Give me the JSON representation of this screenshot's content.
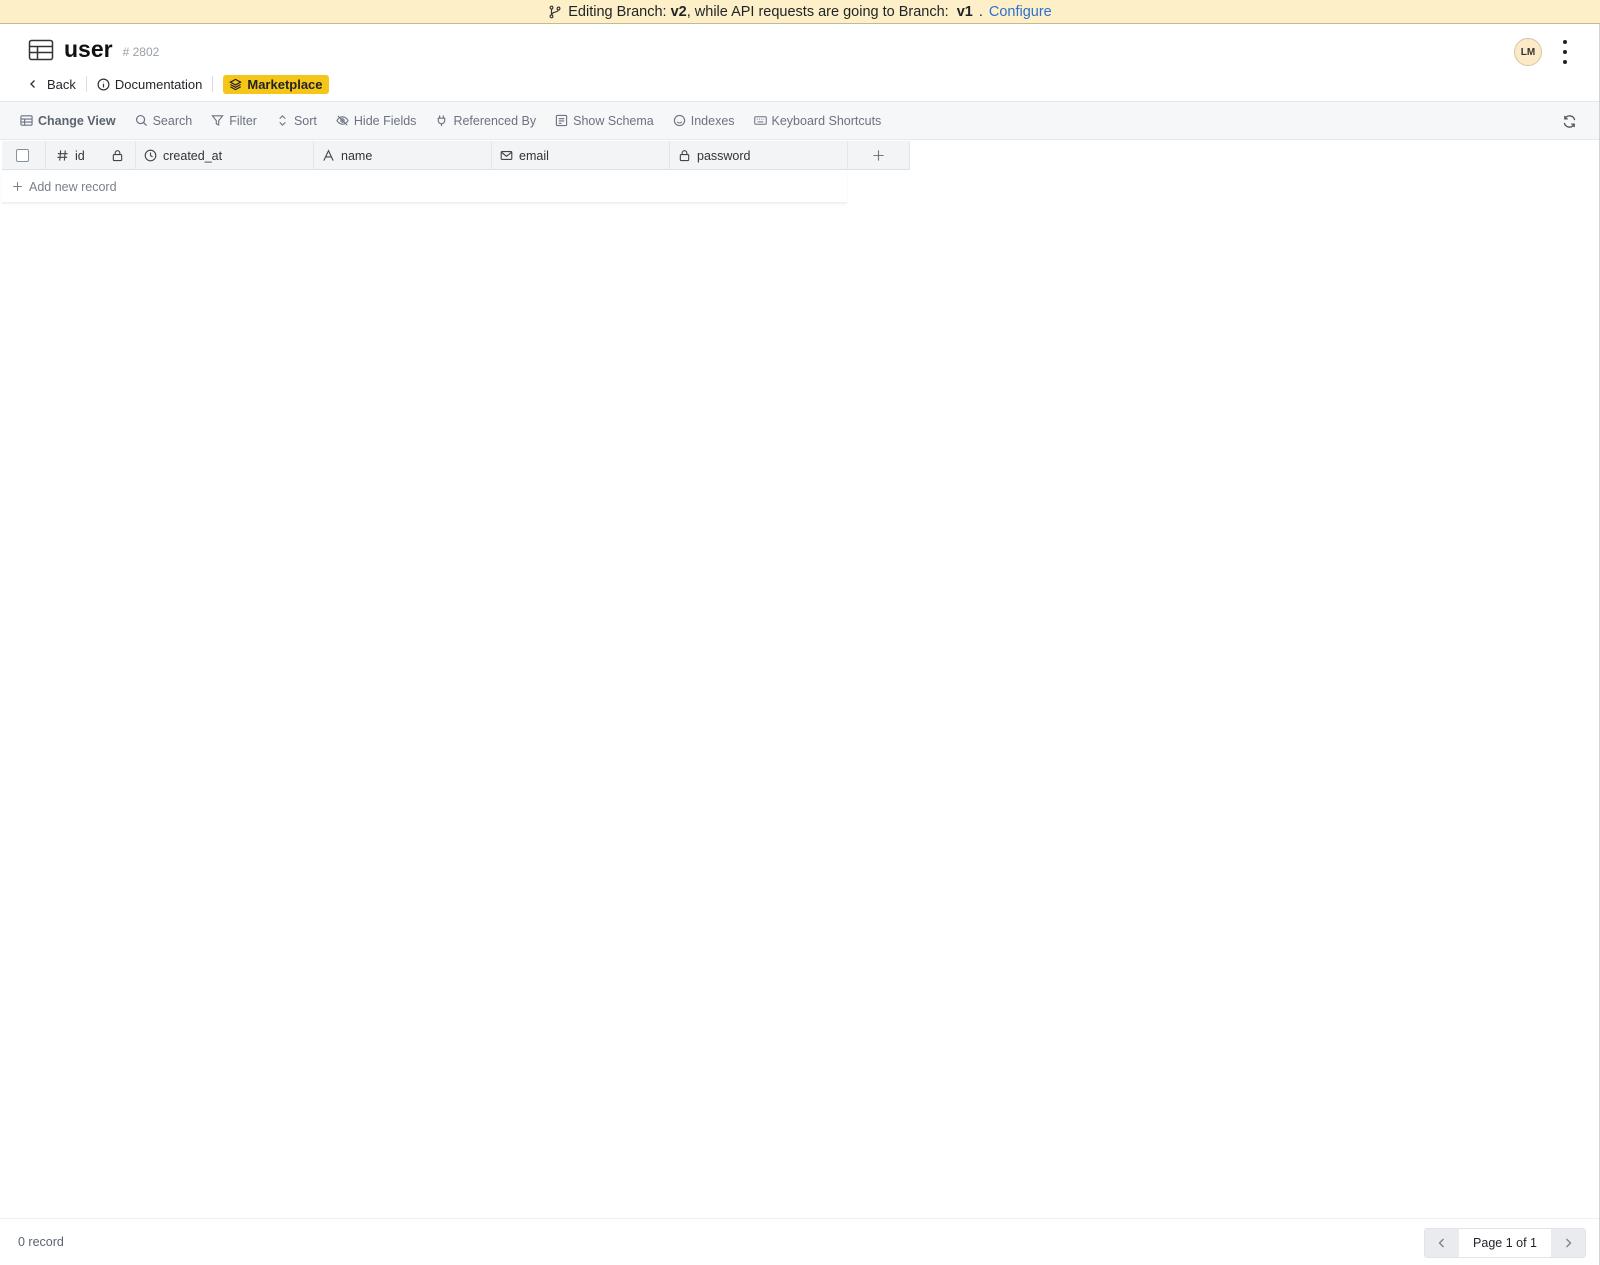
{
  "banner": {
    "prefix": "Editing Branch:",
    "editing_branch": "v2",
    "middle": ", while API requests are going to Branch:",
    "api_branch": "v1",
    "dot": ".",
    "configure": "Configure"
  },
  "header": {
    "title": "user",
    "table_id": "# 2802",
    "avatar_initials": "LM"
  },
  "nav": {
    "back": "Back",
    "documentation": "Documentation",
    "marketplace": "Marketplace"
  },
  "toolbar": {
    "change_view": "Change View",
    "search": "Search",
    "filter": "Filter",
    "sort": "Sort",
    "hide_fields": "Hide Fields",
    "referenced_by": "Referenced By",
    "show_schema": "Show Schema",
    "indexes": "Indexes",
    "keyboard_shortcuts": "Keyboard Shortcuts"
  },
  "grid": {
    "columns": [
      {
        "label": "id",
        "icon": "hash-icon"
      },
      {
        "label": "created_at",
        "icon": "clock-icon"
      },
      {
        "label": "name",
        "icon": "text-icon"
      },
      {
        "label": "email",
        "icon": "mail-icon"
      },
      {
        "label": "password",
        "icon": "lock-icon"
      }
    ],
    "add_record": "Add new record"
  },
  "footer": {
    "record_count": "0 record",
    "page_label": "Page 1 of 1"
  },
  "colors": {
    "banner_bg": "#fdf0c8",
    "marketplace_bg": "#f5c518",
    "configure_link": "#2e6fd1"
  }
}
